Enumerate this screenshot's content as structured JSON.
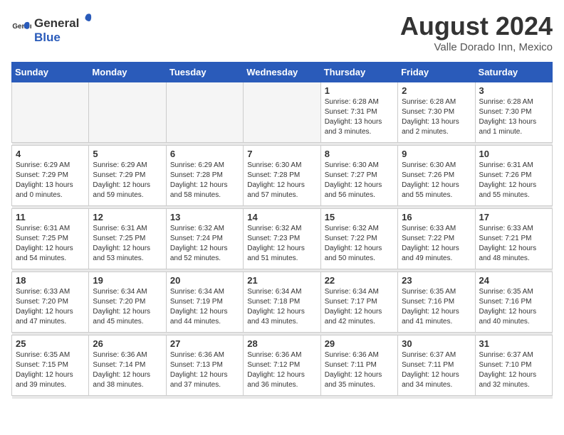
{
  "header": {
    "logo_general": "General",
    "logo_blue": "Blue",
    "title": "August 2024",
    "subtitle": "Valle Dorado Inn, Mexico"
  },
  "days_of_week": [
    "Sunday",
    "Monday",
    "Tuesday",
    "Wednesday",
    "Thursday",
    "Friday",
    "Saturday"
  ],
  "weeks": [
    [
      {
        "day": "",
        "empty": true
      },
      {
        "day": "",
        "empty": true
      },
      {
        "day": "",
        "empty": true
      },
      {
        "day": "",
        "empty": true
      },
      {
        "day": "1",
        "sunrise": "6:28 AM",
        "sunset": "7:31 PM",
        "daylight": "13 hours and 3 minutes."
      },
      {
        "day": "2",
        "sunrise": "6:28 AM",
        "sunset": "7:30 PM",
        "daylight": "13 hours and 2 minutes."
      },
      {
        "day": "3",
        "sunrise": "6:28 AM",
        "sunset": "7:30 PM",
        "daylight": "13 hours and 1 minute."
      }
    ],
    [
      {
        "day": "4",
        "sunrise": "6:29 AM",
        "sunset": "7:29 PM",
        "daylight": "13 hours and 0 minutes."
      },
      {
        "day": "5",
        "sunrise": "6:29 AM",
        "sunset": "7:29 PM",
        "daylight": "12 hours and 59 minutes."
      },
      {
        "day": "6",
        "sunrise": "6:29 AM",
        "sunset": "7:28 PM",
        "daylight": "12 hours and 58 minutes."
      },
      {
        "day": "7",
        "sunrise": "6:30 AM",
        "sunset": "7:28 PM",
        "daylight": "12 hours and 57 minutes."
      },
      {
        "day": "8",
        "sunrise": "6:30 AM",
        "sunset": "7:27 PM",
        "daylight": "12 hours and 56 minutes."
      },
      {
        "day": "9",
        "sunrise": "6:30 AM",
        "sunset": "7:26 PM",
        "daylight": "12 hours and 55 minutes."
      },
      {
        "day": "10",
        "sunrise": "6:31 AM",
        "sunset": "7:26 PM",
        "daylight": "12 hours and 55 minutes."
      }
    ],
    [
      {
        "day": "11",
        "sunrise": "6:31 AM",
        "sunset": "7:25 PM",
        "daylight": "12 hours and 54 minutes."
      },
      {
        "day": "12",
        "sunrise": "6:31 AM",
        "sunset": "7:25 PM",
        "daylight": "12 hours and 53 minutes."
      },
      {
        "day": "13",
        "sunrise": "6:32 AM",
        "sunset": "7:24 PM",
        "daylight": "12 hours and 52 minutes."
      },
      {
        "day": "14",
        "sunrise": "6:32 AM",
        "sunset": "7:23 PM",
        "daylight": "12 hours and 51 minutes."
      },
      {
        "day": "15",
        "sunrise": "6:32 AM",
        "sunset": "7:22 PM",
        "daylight": "12 hours and 50 minutes."
      },
      {
        "day": "16",
        "sunrise": "6:33 AM",
        "sunset": "7:22 PM",
        "daylight": "12 hours and 49 minutes."
      },
      {
        "day": "17",
        "sunrise": "6:33 AM",
        "sunset": "7:21 PM",
        "daylight": "12 hours and 48 minutes."
      }
    ],
    [
      {
        "day": "18",
        "sunrise": "6:33 AM",
        "sunset": "7:20 PM",
        "daylight": "12 hours and 47 minutes."
      },
      {
        "day": "19",
        "sunrise": "6:34 AM",
        "sunset": "7:20 PM",
        "daylight": "12 hours and 45 minutes."
      },
      {
        "day": "20",
        "sunrise": "6:34 AM",
        "sunset": "7:19 PM",
        "daylight": "12 hours and 44 minutes."
      },
      {
        "day": "21",
        "sunrise": "6:34 AM",
        "sunset": "7:18 PM",
        "daylight": "12 hours and 43 minutes."
      },
      {
        "day": "22",
        "sunrise": "6:34 AM",
        "sunset": "7:17 PM",
        "daylight": "12 hours and 42 minutes."
      },
      {
        "day": "23",
        "sunrise": "6:35 AM",
        "sunset": "7:16 PM",
        "daylight": "12 hours and 41 minutes."
      },
      {
        "day": "24",
        "sunrise": "6:35 AM",
        "sunset": "7:16 PM",
        "daylight": "12 hours and 40 minutes."
      }
    ],
    [
      {
        "day": "25",
        "sunrise": "6:35 AM",
        "sunset": "7:15 PM",
        "daylight": "12 hours and 39 minutes."
      },
      {
        "day": "26",
        "sunrise": "6:36 AM",
        "sunset": "7:14 PM",
        "daylight": "12 hours and 38 minutes."
      },
      {
        "day": "27",
        "sunrise": "6:36 AM",
        "sunset": "7:13 PM",
        "daylight": "12 hours and 37 minutes."
      },
      {
        "day": "28",
        "sunrise": "6:36 AM",
        "sunset": "7:12 PM",
        "daylight": "12 hours and 36 minutes."
      },
      {
        "day": "29",
        "sunrise": "6:36 AM",
        "sunset": "7:11 PM",
        "daylight": "12 hours and 35 minutes."
      },
      {
        "day": "30",
        "sunrise": "6:37 AM",
        "sunset": "7:11 PM",
        "daylight": "12 hours and 34 minutes."
      },
      {
        "day": "31",
        "sunrise": "6:37 AM",
        "sunset": "7:10 PM",
        "daylight": "12 hours and 32 minutes."
      }
    ]
  ],
  "labels": {
    "sunrise": "Sunrise:",
    "sunset": "Sunset:",
    "daylight": "Daylight hours"
  }
}
